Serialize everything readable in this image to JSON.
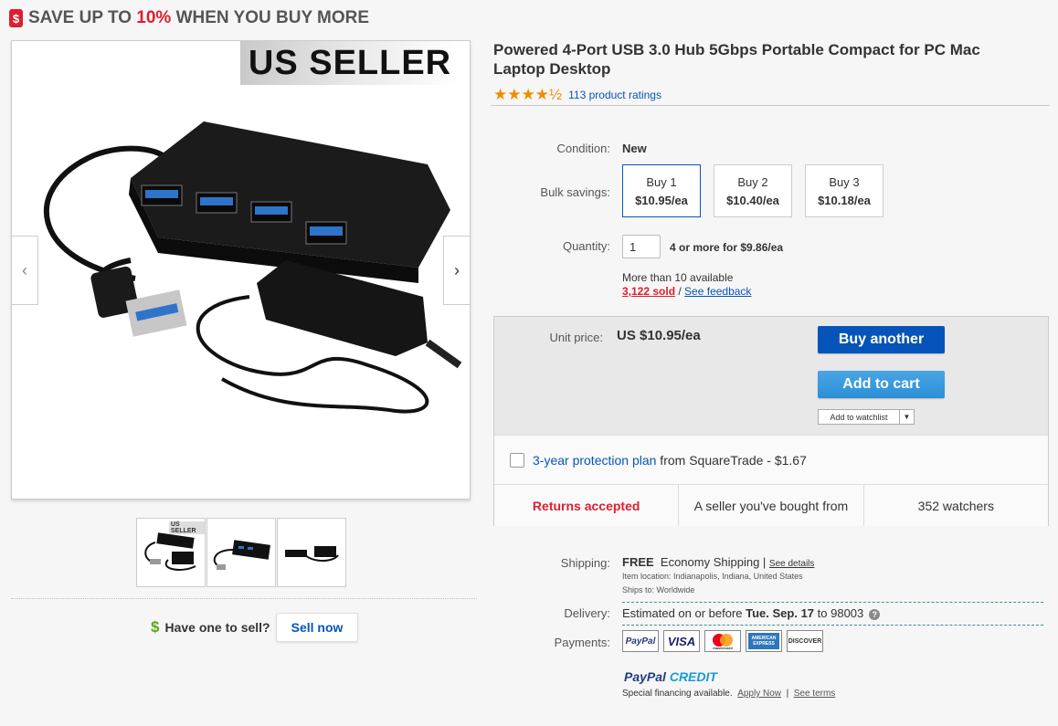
{
  "promo": {
    "prefix": "SAVE UP TO ",
    "percent": "10%",
    "suffix": " WHEN YOU BUY MORE",
    "tag_icon": "$"
  },
  "gallery": {
    "badge": "US SELLER",
    "prev_icon": "chevron-left-icon",
    "next_icon": "chevron-right-icon",
    "thumbs_count": 3,
    "thumb_badge": "US SELLER"
  },
  "sell": {
    "icon": "$",
    "question": "Have one to sell?",
    "button": "Sell now"
  },
  "product": {
    "title": "Powered 4-Port USB 3.0 Hub 5Gbps Portable Compact for PC Mac Laptop Desktop",
    "stars": "★★★★½",
    "rating_value": 4.5,
    "ratings_link": "113 product ratings"
  },
  "details": {
    "condition_label": "Condition:",
    "condition_value": "New",
    "bulk_label": "Bulk savings:",
    "bulk": [
      {
        "qty": "Buy 1",
        "price": "$10.95/ea"
      },
      {
        "qty": "Buy 2",
        "price": "$10.40/ea"
      },
      {
        "qty": "Buy 3",
        "price": "$10.18/ea"
      }
    ],
    "quantity_label": "Quantity:",
    "quantity_value": "1",
    "quantity_deal": "4 or more for $9.86/ea",
    "available": "More than 10 available",
    "sold": "3,122 sold",
    "sep": " / ",
    "feedback": "See feedback"
  },
  "actions": {
    "unit_label": "Unit price:",
    "unit_value": "US $10.95/ea",
    "buy_button": "Buy another",
    "cart_button": "Add to cart",
    "watchlist": "Add to watchlist",
    "protection_link": "3-year protection plan",
    "protection_rest": " from SquareTrade - $1.67",
    "returns": "Returns accepted",
    "seller_note": "A seller you've bought from",
    "watchers": "352 watchers"
  },
  "shipping": {
    "label": "Shipping:",
    "free": "FREE",
    "method": "Economy Shipping |",
    "details_link": "See details",
    "location": "Item location:  Indianapolis, Indiana, United States",
    "ships_to": "Ships to:  Worldwide",
    "delivery_label": "Delivery:",
    "delivery_prefix": "Estimated on or before ",
    "delivery_date": "Tue. Sep. 17",
    "delivery_suffix": " to 98003",
    "payments_label": "Payments:",
    "payment_methods": [
      "PayPal",
      "VISA",
      "mastercard",
      "AMERICAN EXPRESS",
      "DISCOVER"
    ],
    "credit_a": "PayPal",
    "credit_b": " CREDIT",
    "financing": "Special financing available.",
    "apply_link": "Apply Now",
    "terms_link": "See terms"
  },
  "colors": {
    "accent_red": "#dd1e31",
    "link_blue": "#0654ba",
    "star_orange": "#f18c00"
  }
}
